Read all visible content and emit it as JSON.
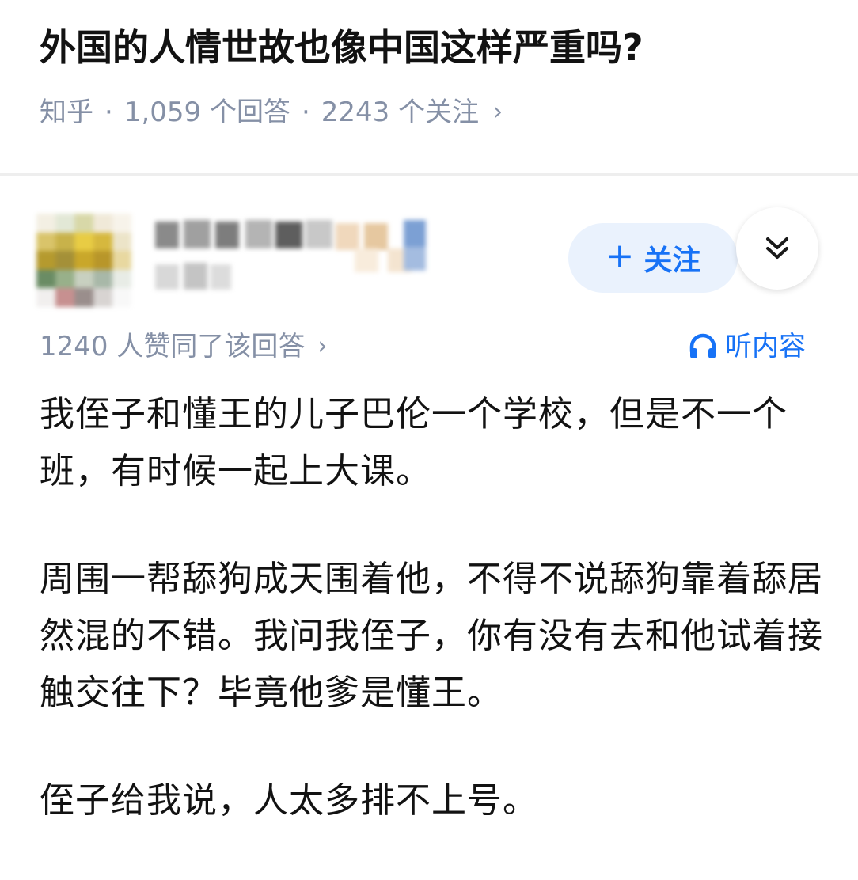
{
  "question": {
    "title": "外国的人情世故也像中国这样严重吗?",
    "source": "知乎",
    "separator": "·",
    "answer_count": "1,059 个回答",
    "follower_count": "2243 个关注",
    "chevron": "›"
  },
  "author": {
    "follow_label": "关注",
    "follow_icon": "plus-icon",
    "collapse_icon": "double-chevron-down-icon"
  },
  "answer": {
    "upvote_text": "1240 人赞同了该回答",
    "upvote_chevron": "›",
    "listen_label": "听内容",
    "listen_icon": "headphones-icon",
    "paragraphs": [
      "我侄子和懂王的儿子巴伦一个学校，但是不一个班，有时候一起上大课。",
      "周围一帮舔狗成天围着他，不得不说舔狗靠着舔居然混的不错。我问我侄子，你有没有去和他试着接触交往下？毕竟他爹是懂王。",
      "侄子给我说，人太多排不上号。"
    ]
  },
  "colors": {
    "accent": "#1772f6",
    "meta_gray": "#8590a6",
    "follow_bg": "#eaf2fd"
  }
}
